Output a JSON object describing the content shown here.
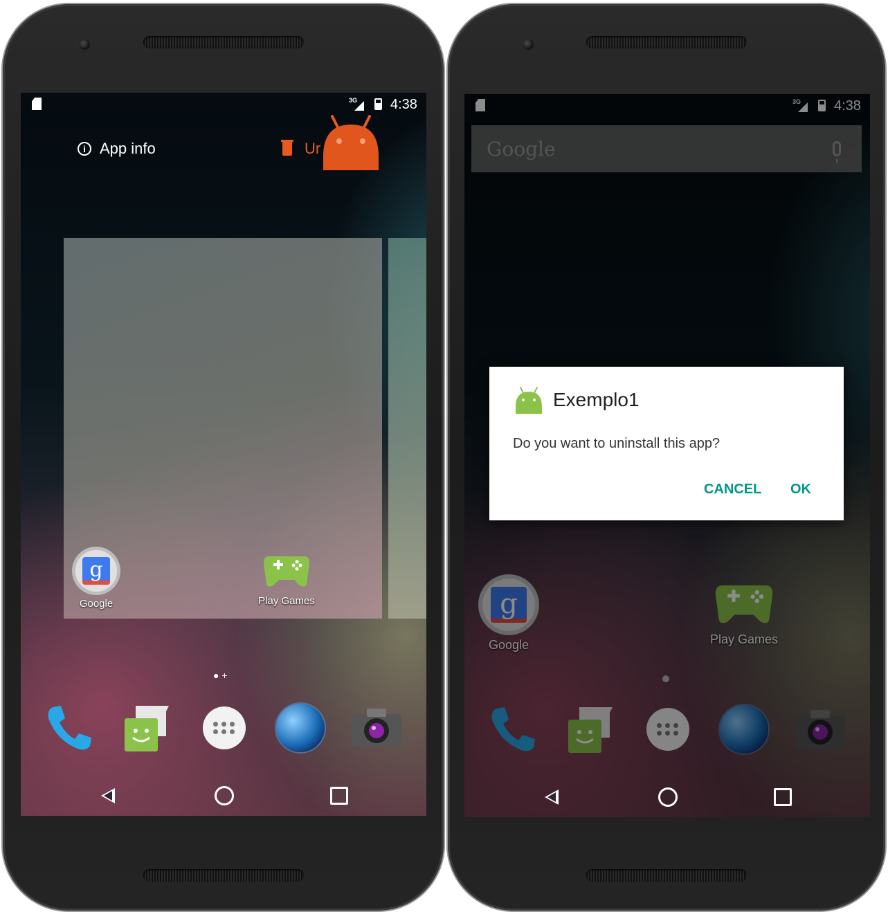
{
  "left_phone": {
    "status": {
      "signal_label": "3G",
      "time": "4:38"
    },
    "drop_targets": {
      "app_info": "App info",
      "uninstall_partial": "Ur"
    },
    "workspace": {
      "apps": [
        {
          "name": "Google"
        },
        {
          "name": "Play Games"
        }
      ],
      "page_indicator": "● +"
    },
    "dock": [
      "phone-icon",
      "messenger-icon",
      "all-apps-icon",
      "browser-icon",
      "camera-icon"
    ]
  },
  "right_phone": {
    "status": {
      "signal_label": "3G",
      "time": "4:38"
    },
    "search": {
      "logo": "Google"
    },
    "dialog": {
      "title": "Exemplo1",
      "message": "Do you want to uninstall this app?",
      "cancel": "CANCEL",
      "ok": "OK"
    },
    "workspace": {
      "apps": [
        {
          "name": "Google"
        },
        {
          "name": "Play Games"
        }
      ]
    }
  },
  "colors": {
    "accent": "#009688",
    "uninstall": "#e95a1f",
    "android_green": "#8bc34a"
  }
}
